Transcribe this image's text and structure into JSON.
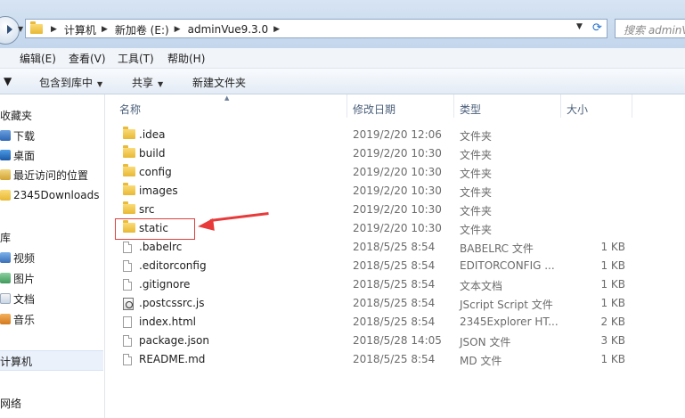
{
  "address": {
    "crumbs": [
      "计算机",
      "新加卷 (E:)",
      "adminVue9.3.0"
    ],
    "search_placeholder": "搜索 adminV"
  },
  "menu": [
    "编辑(E)",
    "查看(V)",
    "工具(T)",
    "帮助(H)"
  ],
  "toolbar": {
    "include_library": "包含到库中",
    "share": "共享",
    "new_folder": "新建文件夹"
  },
  "nav": {
    "favorites": "收藏夹",
    "favorite_items": [
      "下载",
      "桌面",
      "最近访问的位置",
      "2345Downloads"
    ],
    "libraries": "库",
    "library_items": [
      "视频",
      "图片",
      "文档",
      "音乐"
    ],
    "computer": "计算机",
    "network": "网络"
  },
  "columns": {
    "name": "名称",
    "date": "修改日期",
    "type": "类型",
    "size": "大小"
  },
  "files": [
    {
      "name": ".idea",
      "date": "2019/2/20 12:06",
      "type": "文件夹",
      "size": "",
      "icon": "folder"
    },
    {
      "name": "build",
      "date": "2019/2/20 10:30",
      "type": "文件夹",
      "size": "",
      "icon": "folder"
    },
    {
      "name": "config",
      "date": "2019/2/20 10:30",
      "type": "文件夹",
      "size": "",
      "icon": "folder"
    },
    {
      "name": "images",
      "date": "2019/2/20 10:30",
      "type": "文件夹",
      "size": "",
      "icon": "folder"
    },
    {
      "name": "src",
      "date": "2019/2/20 10:30",
      "type": "文件夹",
      "size": "",
      "icon": "folder"
    },
    {
      "name": "static",
      "date": "2019/2/20 10:30",
      "type": "文件夹",
      "size": "",
      "icon": "folder"
    },
    {
      "name": ".babelrc",
      "date": "2018/5/25 8:54",
      "type": "BABELRC 文件",
      "size": "1 KB",
      "icon": "file"
    },
    {
      "name": ".editorconfig",
      "date": "2018/5/25 8:54",
      "type": "EDITORCONFIG ...",
      "size": "1 KB",
      "icon": "file"
    },
    {
      "name": ".gitignore",
      "date": "2018/5/25 8:54",
      "type": "文本文档",
      "size": "1 KB",
      "icon": "file"
    },
    {
      "name": ".postcssrc.js",
      "date": "2018/5/25 8:54",
      "type": "JScript Script 文件",
      "size": "1 KB",
      "icon": "jscript"
    },
    {
      "name": "index.html",
      "date": "2018/5/25 8:54",
      "type": "2345Explorer HT...",
      "size": "2 KB",
      "icon": "web"
    },
    {
      "name": "package.json",
      "date": "2018/5/28 14:05",
      "type": "JSON 文件",
      "size": "3 KB",
      "icon": "file"
    },
    {
      "name": "README.md",
      "date": "2018/5/25 8:54",
      "type": "MD 文件",
      "size": "1 KB",
      "icon": "file"
    }
  ],
  "colors": {
    "annotation": "#e04040",
    "window_chrome": "#c3d6ec"
  }
}
